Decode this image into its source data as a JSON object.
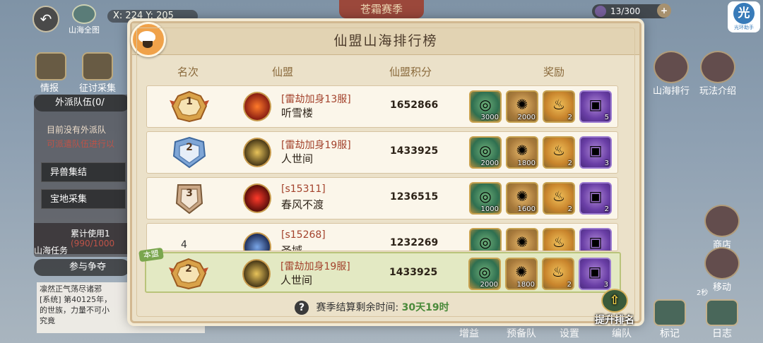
{
  "hud": {
    "map_label": "山海全图",
    "coords": "X: 224  Y: 205",
    "season_title": "苍霜赛季",
    "counter": "13/300",
    "helper_logo_char": "光",
    "helper_logo_label": "光环助手"
  },
  "left": {
    "btn1": "情报",
    "btn2": "征讨采集",
    "tab": "外派队伍(0/",
    "notice_line1": "目前没有外派队",
    "notice_line2": "可派遣队伍进行以",
    "item1": "异兽集结",
    "item2": "宝地采集",
    "cum_label": "累计使用1",
    "cum_value": "(990/1000",
    "task_label": "山海任务",
    "compete": "参与争夺",
    "chat_line1": "凛然正气荡尽诸邪",
    "chat_line2": "[系统] 第40125年，",
    "chat_line3": "的世族，力量不可小",
    "chat_line4": "究竟"
  },
  "right": {
    "btn1": "山海排行",
    "btn2": "玩法介绍",
    "btn3": "商店",
    "btn4": "移动",
    "btn4_sub": "2秒"
  },
  "bottom": {
    "b1": "增益",
    "b2": "预备队",
    "b3": "设置",
    "b4": "编队",
    "b5": "标记",
    "b6": "日志"
  },
  "modal": {
    "title": "仙盟山海排行榜",
    "headers": {
      "rank": "名次",
      "alliance": "仙盟",
      "score": "仙盟积分",
      "reward": "奖励"
    },
    "rows": [
      {
        "rank": "1",
        "server": "[雷劫加身13服]",
        "name": "听雪楼",
        "score": "1652866",
        "rewards": [
          "3000",
          "2000",
          "2",
          "5"
        ]
      },
      {
        "rank": "2",
        "server": "[雷劫加身19服]",
        "name": "人世间",
        "score": "1433925",
        "rewards": [
          "2000",
          "1800",
          "2",
          "3"
        ]
      },
      {
        "rank": "3",
        "server": "[s15311]",
        "name": "春风不渡",
        "score": "1236515",
        "rewards": [
          "1000",
          "1600",
          "2",
          "2"
        ]
      },
      {
        "rank": "4",
        "server": "[s15268]",
        "name": "圣域",
        "score": "1232269",
        "rewards": [
          "",
          "",
          "",
          ""
        ]
      }
    ],
    "mine": {
      "tag": "本盟",
      "rank": "2",
      "server": "[雷劫加身19服]",
      "name": "人世间",
      "score": "1433925",
      "rewards": [
        "2000",
        "1800",
        "2",
        "3"
      ]
    },
    "timer_label": "赛季结算剩余时间:",
    "timer_value": "30天19时",
    "boost_label": "提升排名"
  },
  "colors": {
    "gold_badge": "#d9a24a",
    "silver_badge": "#7fa6d6",
    "bronze_badge": "#caa786"
  },
  "icons": [
    "back-icon",
    "map-icon",
    "gem-icon",
    "mascot-icon",
    "jade-icon",
    "merit-icon",
    "flame-icon",
    "treasure-box-icon",
    "question-icon",
    "boost-icon"
  ]
}
